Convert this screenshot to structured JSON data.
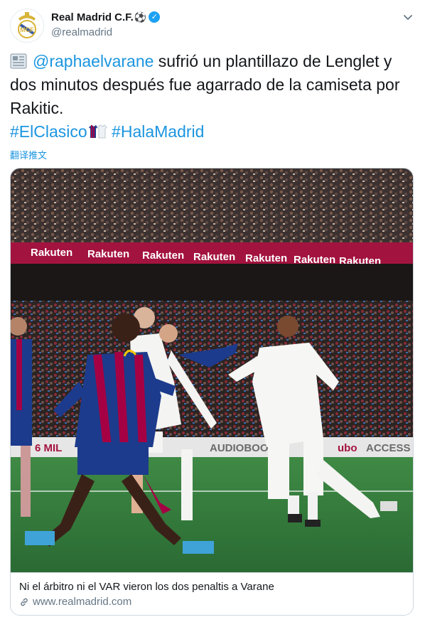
{
  "author": {
    "display_name": "Real Madrid C.F.",
    "name_emoji": "⚽",
    "verified_mark": "✓",
    "handle": "@realmadrid"
  },
  "tweet": {
    "mention": "@raphaelvarane",
    "text_part1": " sufrió un plantillazo de Lenglet y dos minutos después fue agarrado de la camiseta por Rakitic.",
    "hashtag1": "#ElClasico",
    "hashtag2": "#HalaMadrid"
  },
  "translate_label": "翻译推文",
  "card": {
    "title": "Ni el árbitro ni el VAR vieron los dos penaltis a Varane",
    "domain": "www.realmadrid.com",
    "banner_ads": [
      "Rakuten",
      "Rakuten",
      "Rakuten",
      "Rakuten",
      "Rakuten",
      "Rakuten",
      "Rakuten"
    ],
    "board_texts": [
      "6 MIL",
      "AUDIOBOO",
      "ACCESS",
      "ubo"
    ]
  },
  "colors": {
    "link": "#1b95e0",
    "verified": "#1da1f2",
    "secondary_text": "#657786",
    "barca_blue": "#1d3b8c",
    "barca_red": "#a50044",
    "pitch_green": "#2f7a3c",
    "banner_red": "#a3133f"
  },
  "icons": {
    "news": "newspaper-emoji",
    "shirts": "shirts-emoji",
    "menu": "chevron-down-icon",
    "link": "link-icon"
  }
}
